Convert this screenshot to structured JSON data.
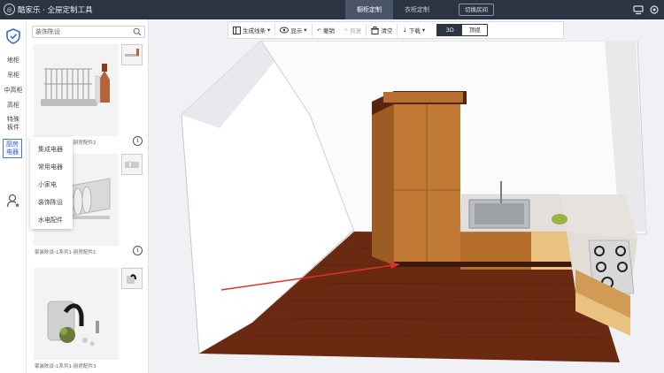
{
  "topbar": {
    "app_name": "酷家乐 · 全屋定制工具",
    "tabs": [
      {
        "label": "橱柜定制",
        "active": true
      },
      {
        "label": "衣柜定制",
        "active": false
      }
    ],
    "switch_room_label": "切换房间",
    "icons": [
      "monitor-icon",
      "settings-icon"
    ]
  },
  "rail": {
    "items": [
      {
        "label": "地柜"
      },
      {
        "label": "吊柜"
      },
      {
        "label": "中高柜"
      },
      {
        "label": "高柜"
      },
      {
        "label": "特殊\n板件"
      },
      {
        "label": "厨房\n电器",
        "active": true
      }
    ]
  },
  "catalog": {
    "search_placeholder": "装饰陈设",
    "items": [
      {
        "name": "家装陈设-1系列1-厨房配件2"
      },
      {
        "name": "家装陈设-1系列1-厨房配件1"
      },
      {
        "name": "家装陈设-1系列1-厨房配件3"
      }
    ]
  },
  "submenu": {
    "items": [
      "集成电器",
      "常用电器",
      "小家电",
      "装饰陈设",
      "水电配件"
    ]
  },
  "toolbar": {
    "line_label": "生成线条",
    "show_label": "显示",
    "undo_label": "撤销",
    "redo_label": "恢复",
    "clear_label": "清空",
    "download_label": "下载",
    "view_3d": "3D",
    "view_plan": "顶视",
    "active_view": "3D"
  },
  "colors": {
    "topbar": "#2c3443",
    "accent": "#3b6ad0",
    "wood": "#c07a35",
    "floor": "#6a2a12",
    "arrow": "#e0302a"
  }
}
